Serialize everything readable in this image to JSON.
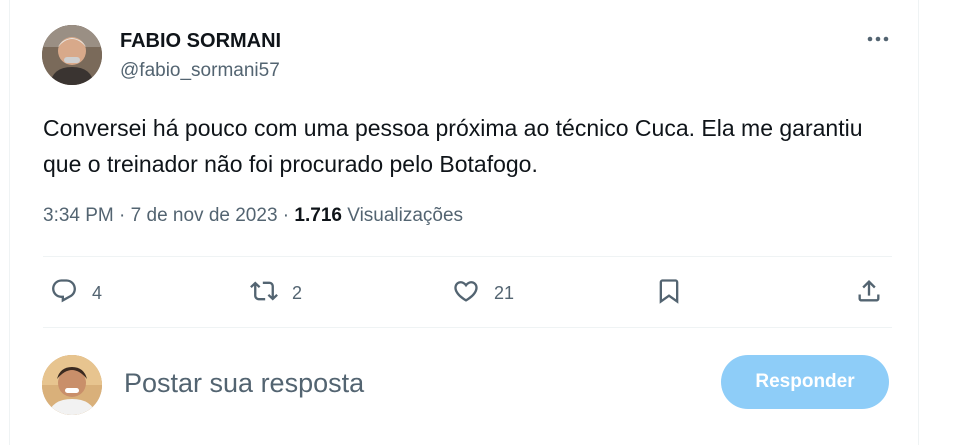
{
  "tweet": {
    "author_name": "FABIO SORMANI",
    "author_handle": "@fabio_sormani57",
    "text": "Conversei há pouco com uma pessoa próxima ao técnico Cuca. Ela me garantiu que o treinador não foi procurado pelo Botafogo.",
    "time": "3:34 PM",
    "date": "7 de nov de 2023",
    "separator": "·",
    "views_count": "1.716",
    "views_label": "Visualizações"
  },
  "actions": {
    "reply_count": "4",
    "retweet_count": "2",
    "like_count": "21"
  },
  "reply_box": {
    "placeholder": "Postar sua resposta",
    "value": "",
    "button_label": "Responder"
  },
  "icons": {
    "more": "more-icon",
    "reply": "reply-icon",
    "retweet": "retweet-icon",
    "like": "heart-icon",
    "bookmark": "bookmark-icon",
    "share": "share-icon"
  },
  "colors": {
    "text": "#0f1419",
    "secondary_text": "#536471",
    "button_disabled": "#8ecdf8",
    "divider": "#eff3f4"
  }
}
